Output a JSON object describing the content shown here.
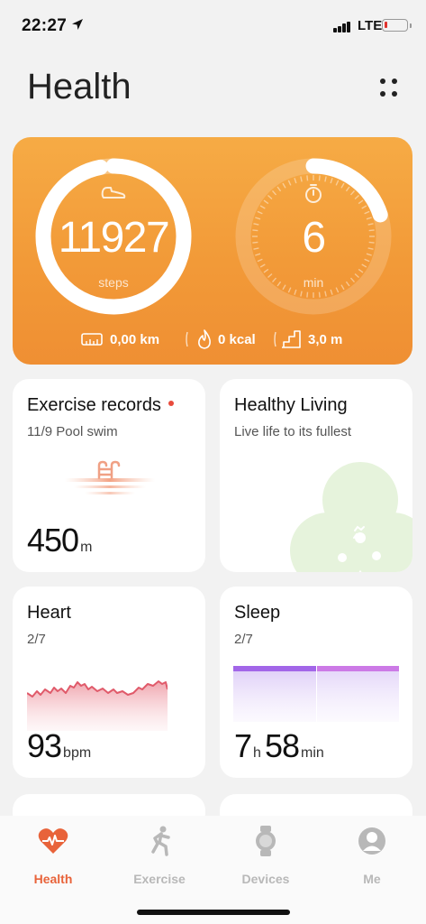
{
  "status": {
    "time": "22:27",
    "network": "LTE",
    "icons": [
      "location-arrow-icon",
      "signal-icon",
      "battery-icon"
    ]
  },
  "header": {
    "title": "Health",
    "menu_icon": "more-icon"
  },
  "activity": {
    "steps": {
      "value": "11927",
      "unit": "steps",
      "progress": 0.97
    },
    "minutes": {
      "value": "6",
      "unit": "min",
      "progress": 0.2
    },
    "distance": "0,00 km",
    "calories": "0 kcal",
    "floors": "3,0 m"
  },
  "cards": {
    "exercise": {
      "title": "Exercise records",
      "subtitle": "11/9 Pool swim",
      "value": "450",
      "unit": "m"
    },
    "living": {
      "title": "Healthy Living",
      "subtitle": "Live life to its fullest"
    },
    "heart": {
      "title": "Heart",
      "subtitle": "2/7",
      "value": "93",
      "unit": "bpm"
    },
    "sleep": {
      "title": "Sleep",
      "subtitle": "2/7",
      "hours": "7",
      "hours_unit": "h",
      "minutes": "58",
      "minutes_unit": "min"
    }
  },
  "tabs": [
    {
      "label": "Health",
      "icon": "heart-icon",
      "active": true
    },
    {
      "label": "Exercise",
      "icon": "running-icon",
      "active": false
    },
    {
      "label": "Devices",
      "icon": "watch-icon",
      "active": false
    },
    {
      "label": "Me",
      "icon": "avatar-icon",
      "active": false
    }
  ],
  "colors": {
    "accent": "#e8633a",
    "activity": "#f29a38",
    "heart": "#e05a6a",
    "sleep": "#a266e8"
  }
}
